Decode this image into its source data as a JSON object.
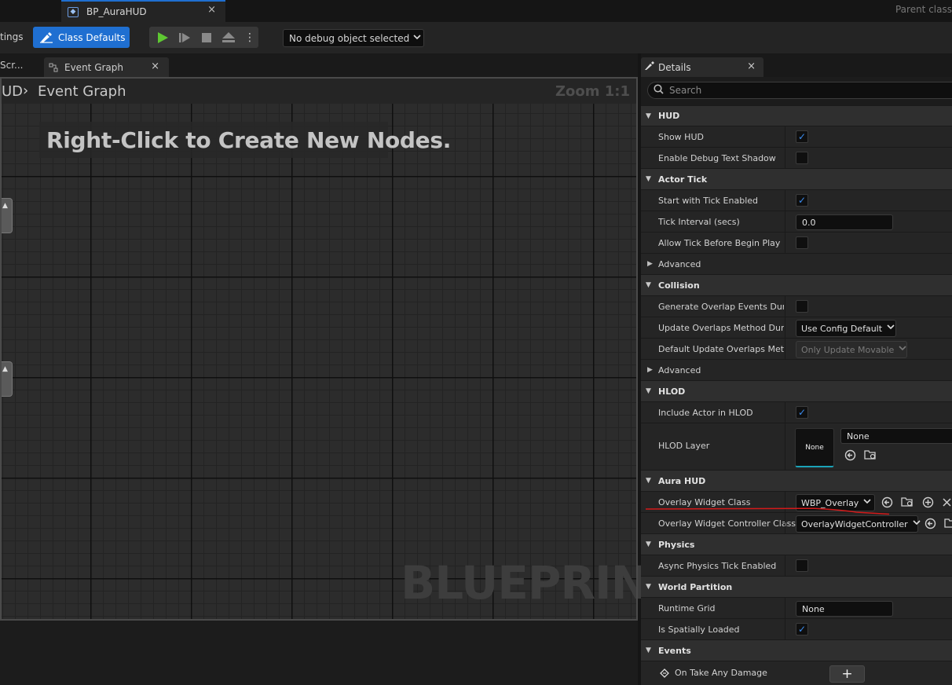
{
  "title_bar": {
    "doc_tab_label": "BP_AuraHUD",
    "doc_tab_close": "×",
    "parent_class": "Parent class"
  },
  "toolbar": {
    "settings_label": "tings",
    "class_defaults_label": "Class Defaults",
    "more": "⋮",
    "debug_select_value": "No debug object selected",
    "accent_color": "#1f6fd1",
    "play_color": "#5ec832"
  },
  "graph_tabs": {
    "partial_tab_label": "Scr...",
    "event_graph_tab_label": "Event Graph",
    "close": "×"
  },
  "graph": {
    "breadcrumb_partial": "UD",
    "breadcrumb_sep": "›",
    "breadcrumb_current": "Event Graph",
    "zoom": "Zoom 1:1",
    "hint": "Right-Click to Create New Nodes.",
    "watermark": "BLUEPRINT"
  },
  "details": {
    "tab_label": "Details",
    "tab_close": "×",
    "search_placeholder": "Search",
    "categories": {
      "hud": {
        "label": "HUD",
        "show_hud": {
          "name": "Show HUD",
          "checked": true
        },
        "enable_debug_text_shadow": {
          "name": "Enable Debug Text Shadow",
          "checked": false
        }
      },
      "actor_tick": {
        "label": "Actor Tick",
        "start_with_tick_enabled": {
          "name": "Start with Tick Enabled",
          "checked": true
        },
        "tick_interval": {
          "name": "Tick Interval (secs)",
          "value": "0.0"
        },
        "allow_tick_before_begin_play": {
          "name": "Allow Tick Before Begin Play",
          "checked": false
        },
        "advanced": "Advanced"
      },
      "collision": {
        "label": "Collision",
        "generate_overlap_events": {
          "name": "Generate Overlap Events Durin..."
        },
        "update_overlaps_method": {
          "name": "Update Overlaps Method Durin...",
          "value": "Use Config Default"
        },
        "default_update_overlaps_method": {
          "name": "Default Update Overlaps Meth...",
          "value": "Only Update Movable"
        },
        "advanced": "Advanced"
      },
      "hlod": {
        "label": "HLOD",
        "include_actor_in_hlod": {
          "name": "Include Actor in HLOD",
          "checked": true
        },
        "hlod_layer": {
          "name": "HLOD Layer",
          "thumb_label": "None",
          "value": "None"
        }
      },
      "aura_hud": {
        "label": "Aura HUD",
        "overlay_widget_class": {
          "name": "Overlay Widget Class",
          "value": "WBP_Overlay"
        },
        "overlay_widget_controller_class": {
          "name": "Overlay Widget Controller Class",
          "value": "OverlayWidgetController"
        }
      },
      "physics": {
        "label": "Physics",
        "async_physics_tick_enabled": {
          "name": "Async Physics Tick Enabled",
          "checked": false
        }
      },
      "world_partition": {
        "label": "World Partition",
        "runtime_grid": {
          "name": "Runtime Grid",
          "value": "None"
        },
        "is_spatially_loaded": {
          "name": "Is Spatially Loaded",
          "checked": true
        }
      },
      "events": {
        "label": "Events",
        "on_take_any_damage": {
          "name": "On Take Any Damage",
          "add": "+"
        }
      }
    },
    "check_glyph": "✓",
    "annotation_color": "#d41a1a"
  }
}
